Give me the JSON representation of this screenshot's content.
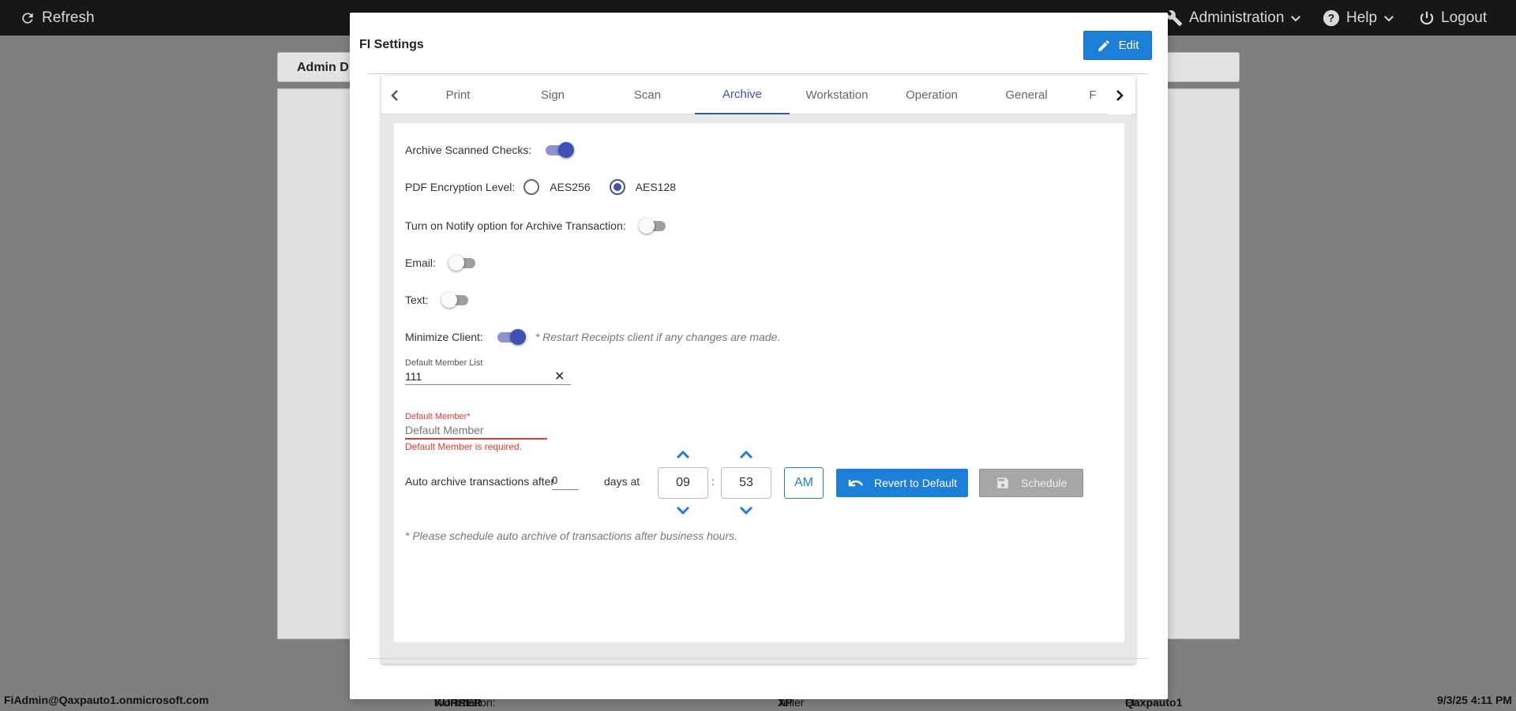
{
  "topbar": {
    "refresh_label": "Refresh",
    "administration_label": "Administration",
    "help_label": "Help",
    "logout_label": "Logout"
  },
  "background": {
    "panel_title": "Admin D"
  },
  "footer": {
    "user": "FiAdmin@Qaxpauto1.onmicrosoft.com",
    "workstation_label": "Workstation:",
    "workstation_value": "KURRER",
    "teller_label": "Teller Platform:",
    "teller_value": "XP",
    "fi_label": "FI:",
    "fi_value": "Qaxpauto1",
    "datetime": "9/3/25 4:11 PM"
  },
  "modal": {
    "title": "FI Settings",
    "edit_label": "Edit",
    "tabs": [
      {
        "label": "Print"
      },
      {
        "label": "Sign"
      },
      {
        "label": "Scan"
      },
      {
        "label": "Archive",
        "active": true
      },
      {
        "label": "Workstation"
      },
      {
        "label": "Operation"
      },
      {
        "label": "General"
      },
      {
        "label": "F"
      }
    ],
    "archive": {
      "archive_scanned_checks_label": "Archive Scanned Checks:",
      "archive_scanned_checks_on": true,
      "pdf_encryption_label": "PDF Encryption Level:",
      "encryption_options": [
        "AES256",
        "AES128"
      ],
      "encryption_selected": "AES128",
      "notify_label": "Turn on Notify option for Archive Transaction:",
      "notify_on": false,
      "email_label": "Email:",
      "email_on": false,
      "text_label": "Text:",
      "text_on": false,
      "minimize_label": "Minimize Client:",
      "minimize_on": true,
      "minimize_note": "* Restart Receipts client if any changes are made.",
      "default_member_list_label": "Default Member List",
      "default_member_list_value": "111",
      "default_member_label": "Default Member*",
      "default_member_placeholder": "Default Member",
      "default_member_error": "Default Member is required.",
      "auto_archive_label": "Auto archive transactions after",
      "days_value": "0",
      "days_at_label": "days at",
      "hour": "09",
      "time_sep": ":",
      "minute": "53",
      "ampm": "AM",
      "revert_label": "Revert to Default",
      "schedule_label": "Schedule",
      "schedule_note": "* Please schedule auto archive of transactions after business hours."
    }
  },
  "colors": {
    "accent": "#1e7fd8",
    "toggle_on": "#3f51b5",
    "error": "#e53935"
  }
}
